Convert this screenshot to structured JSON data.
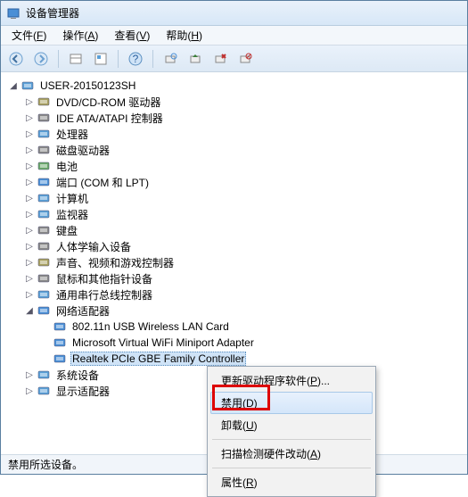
{
  "title": "设备管理器",
  "menus": [
    {
      "label": "文件",
      "key": "F"
    },
    {
      "label": "操作",
      "key": "A"
    },
    {
      "label": "查看",
      "key": "V"
    },
    {
      "label": "帮助",
      "key": "H"
    }
  ],
  "root": "USER-20150123SH",
  "nodes": [
    {
      "icon": "disc",
      "label": "DVD/CD-ROM 驱动器",
      "exp": ">"
    },
    {
      "icon": "ide",
      "label": "IDE ATA/ATAPI 控制器",
      "exp": ">"
    },
    {
      "icon": "cpu",
      "label": "处理器",
      "exp": ">"
    },
    {
      "icon": "disk",
      "label": "磁盘驱动器",
      "exp": ">"
    },
    {
      "icon": "batt",
      "label": "电池",
      "exp": ">"
    },
    {
      "icon": "port",
      "label": "端口 (COM 和 LPT)",
      "exp": ">"
    },
    {
      "icon": "pc",
      "label": "计算机",
      "exp": ">"
    },
    {
      "icon": "monitor",
      "label": "监视器",
      "exp": ">"
    },
    {
      "icon": "kbd",
      "label": "键盘",
      "exp": ">"
    },
    {
      "icon": "hid",
      "label": "人体学输入设备",
      "exp": ">"
    },
    {
      "icon": "media",
      "label": "声音、视频和游戏控制器",
      "exp": ">"
    },
    {
      "icon": "mouse",
      "label": "鼠标和其他指针设备",
      "exp": ">"
    },
    {
      "icon": "usb",
      "label": "通用串行总线控制器",
      "exp": ">"
    }
  ],
  "netcat": {
    "icon": "net",
    "label": "网络适配器",
    "exp": "v"
  },
  "netitems": [
    {
      "icon": "netcard",
      "label": "802.11n USB Wireless LAN Card"
    },
    {
      "icon": "netcard",
      "label": "Microsoft Virtual WiFi Miniport Adapter"
    },
    {
      "icon": "netcard",
      "label": "Realtek PCIe GBE Family Controller",
      "sel": true
    }
  ],
  "tail": [
    {
      "icon": "sys",
      "label": "系统设备",
      "exp": ">"
    },
    {
      "icon": "display",
      "label": "显示适配器",
      "exp": ">"
    }
  ],
  "context": [
    {
      "label": "更新驱动程序软件(P)...",
      "type": "item"
    },
    {
      "label": "禁用(D)",
      "type": "item",
      "hover": true
    },
    {
      "label": "卸载(U)",
      "type": "item"
    },
    {
      "type": "sep"
    },
    {
      "label": "扫描检测硬件改动(A)",
      "type": "item"
    },
    {
      "type": "sep"
    },
    {
      "label": "属性(R)",
      "type": "item"
    }
  ],
  "status": "禁用所选设备。"
}
